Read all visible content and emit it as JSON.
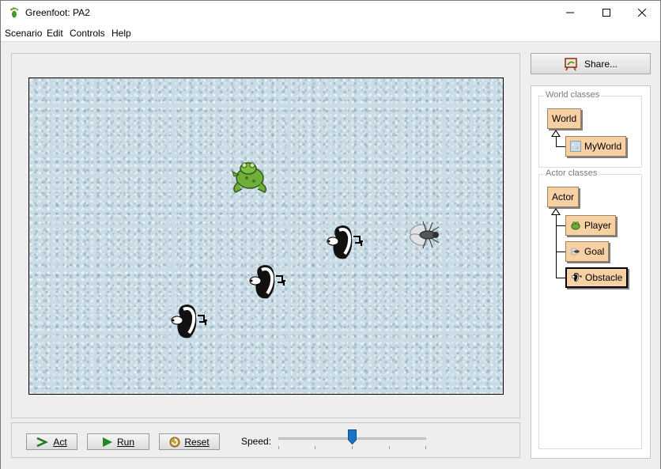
{
  "window": {
    "title": "Greenfoot: PA2",
    "minimize_icon": "minimize-icon",
    "maximize_icon": "maximize-icon",
    "close_icon": "close-icon"
  },
  "menubar": {
    "items": [
      {
        "label": "Scenario"
      },
      {
        "label": "Edit"
      },
      {
        "label": "Controls"
      },
      {
        "label": "Help"
      }
    ]
  },
  "world": {
    "actors": [
      {
        "name": "frog",
        "icon": "frog-icon"
      },
      {
        "name": "fly",
        "icon": "fly-icon"
      },
      {
        "name": "skunk-1",
        "icon": "skunk-icon"
      },
      {
        "name": "skunk-2",
        "icon": "skunk-icon"
      },
      {
        "name": "skunk-3",
        "icon": "skunk-icon"
      }
    ]
  },
  "controls": {
    "act_label": "Act",
    "run_label": "Run",
    "reset_label": "Reset",
    "speed_label": "Speed:",
    "speed_fraction": 0.5
  },
  "share": {
    "label": "Share..."
  },
  "classes": {
    "world_group_title": "World classes",
    "world": "World",
    "my_world": "MyWorld",
    "actor_group_title": "Actor classes",
    "actor": "Actor",
    "player": "Player",
    "goal": "Goal",
    "obstacle": "Obstacle",
    "selected": "Obstacle"
  },
  "colors": {
    "class_box": "#f7d0a4",
    "world_background": "#c9dbe4",
    "slider_thumb": "#1a73c8"
  }
}
